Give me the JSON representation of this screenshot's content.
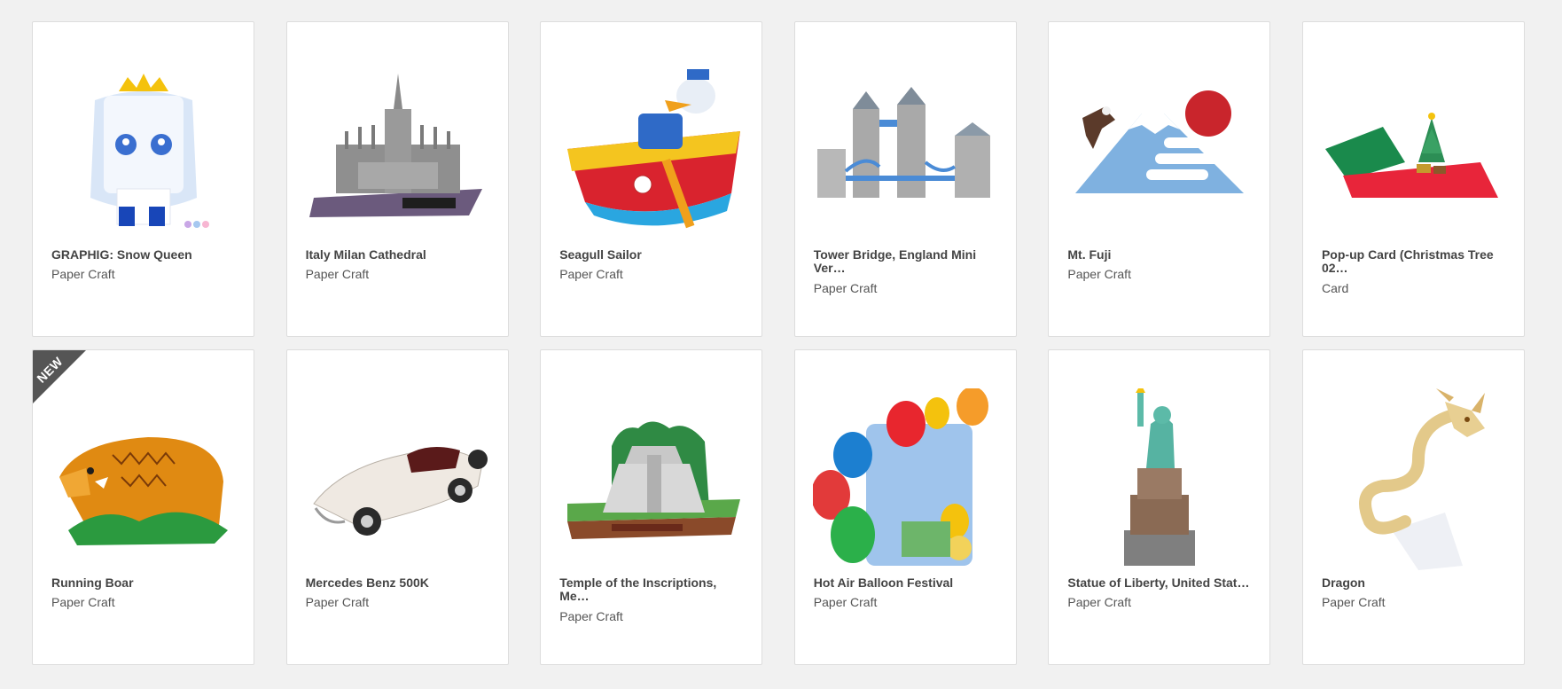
{
  "ribbon_label": "NEW",
  "products": [
    {
      "title": "GRAPHIG: Snow Queen",
      "category": "Paper Craft",
      "image": "snow-queen-image"
    },
    {
      "title": "Italy Milan Cathedral",
      "category": "Paper Craft",
      "image": "milan-cathedral-image"
    },
    {
      "title": "Seagull Sailor",
      "category": "Paper Craft",
      "image": "seagull-sailor-image"
    },
    {
      "title": "Tower Bridge, England Mini Ver…",
      "category": "Paper Craft",
      "image": "tower-bridge-image"
    },
    {
      "title": "Mt. Fuji",
      "category": "Paper Craft",
      "image": "mt-fuji-image"
    },
    {
      "title": "Pop-up Card (Christmas Tree 02…",
      "category": "Card",
      "image": "christmas-tree-card-image"
    },
    {
      "title": "Running Boar",
      "category": "Paper Craft",
      "image": "running-boar-image",
      "badge": "NEW"
    },
    {
      "title": "Mercedes Benz 500K",
      "category": "Paper Craft",
      "image": "mercedes-benz-image"
    },
    {
      "title": "Temple of the Inscriptions, Me…",
      "category": "Paper Craft",
      "image": "temple-image"
    },
    {
      "title": "Hot Air Balloon Festival",
      "category": "Paper Craft",
      "image": "hot-air-balloon-image"
    },
    {
      "title": "Statue of Liberty, United Stat…",
      "category": "Paper Craft",
      "image": "statue-of-liberty-image"
    },
    {
      "title": "Dragon",
      "category": "Paper Craft",
      "image": "dragon-image"
    }
  ]
}
